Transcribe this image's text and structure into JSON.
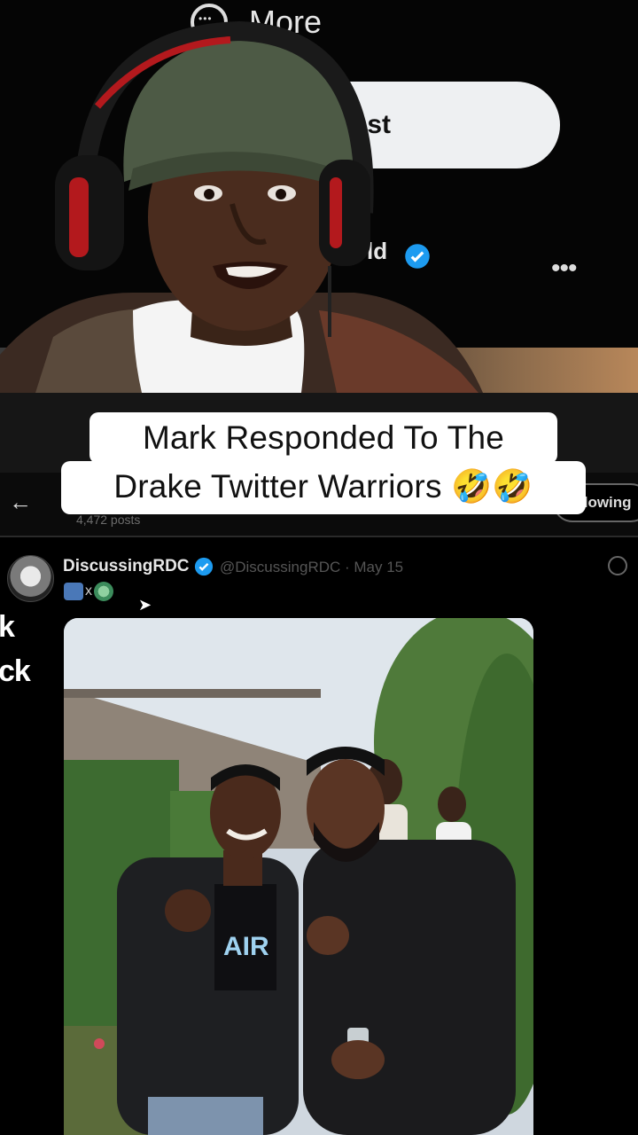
{
  "webcam": {
    "menu_more_label": "More",
    "post_button_label": "Post",
    "world_text": "orld"
  },
  "caption": {
    "line1": "Mark Responded To The",
    "line2": "Drake Twitter Warriors 🤣🤣"
  },
  "profile_header": {
    "posts_count": "4,472 posts",
    "following_label": "llowing"
  },
  "tweet": {
    "display_name": "DiscussingRDC",
    "handle_and_date": "@DiscussingRDC · May 15",
    "emoji_sep": "x",
    "side_text": "k\nck"
  },
  "colors": {
    "verified": "#1d9bf0",
    "caption_bg": "#ffffff",
    "caption_text": "#111111"
  },
  "icons": {
    "more": "more-circle-icon",
    "verified": "verified-badge-icon",
    "back": "back-arrow-icon",
    "grok": "grok-icon",
    "ellipsis": "ellipsis-icon",
    "cursor": "mouse-cursor-icon"
  }
}
